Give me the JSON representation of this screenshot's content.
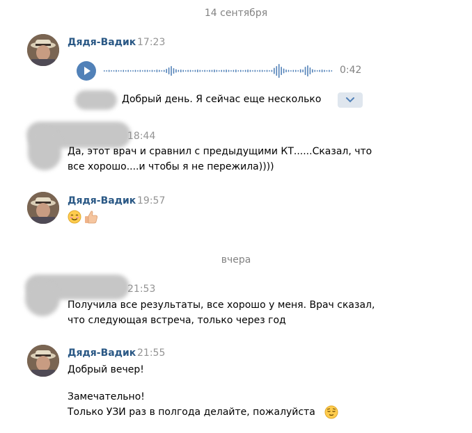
{
  "colors": {
    "author": "#2a5885",
    "accent": "#5181b8",
    "muted": "#939393",
    "date_separator": "#828282"
  },
  "separators": {
    "first": "14 сентября",
    "second": "вчера"
  },
  "messages": {
    "m1": {
      "author": "Дядя-Вадик",
      "time": "17:23",
      "voice_duration": "0:42",
      "transcript": "Добрый день. Я сейчас еще несколько",
      "icons": [
        "play-icon",
        "chevron-down-icon"
      ]
    },
    "m2": {
      "time": "18:44",
      "text": "Да, этот врач и сравнил с предыдущими КТ......Сказал, что\nвсе хорошо....и чтобы я не пережила))))"
    },
    "m3": {
      "author": "Дядя-Вадик",
      "time": "19:57",
      "emojis": [
        "smiling-face-emoji",
        "thumbs-up-emoji"
      ]
    },
    "m4": {
      "time": "21:53",
      "text": "Получила все результаты, все хорошо у меня. Врач сказал,\nчто следующая встреча, только через год"
    },
    "m5": {
      "author": "Дядя-Вадик",
      "time": "21:55",
      "line1": "Добрый вечер!",
      "line2": "Замечательно!",
      "line3": "Только УЗИ раз в полгода делайте, пожалуйста",
      "emojis": [
        "relieved-face-emoji"
      ]
    }
  }
}
